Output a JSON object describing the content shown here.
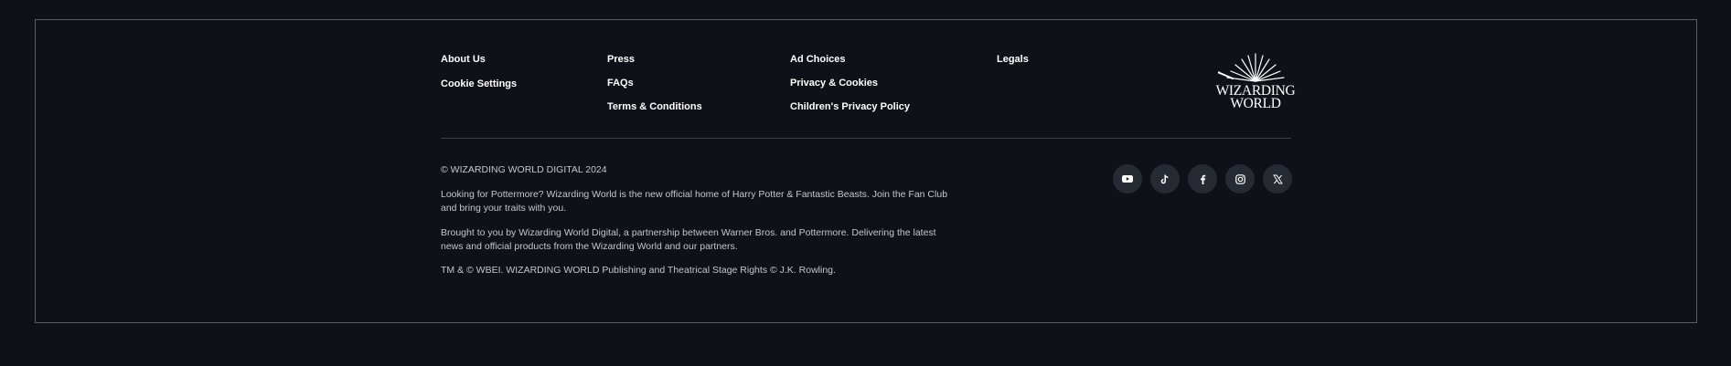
{
  "footer": {
    "nav_columns": [
      {
        "links": [
          {
            "label": "About Us"
          },
          {
            "label": "Cookie Settings"
          }
        ]
      },
      {
        "links": [
          {
            "label": "Press"
          },
          {
            "label": "FAQs"
          },
          {
            "label": "Terms & Conditions"
          }
        ]
      },
      {
        "links": [
          {
            "label": "Ad Choices"
          },
          {
            "label": "Privacy & Cookies"
          },
          {
            "label": "Children's Privacy Policy"
          }
        ]
      },
      {
        "links": [
          {
            "label": "Legals"
          }
        ]
      }
    ],
    "logo": {
      "line1": "WIZARDING",
      "line2": "WORLD"
    },
    "copyright": "© WIZARDING WORLD DIGITAL 2024",
    "pottermore_text": "Looking for Pottermore? Wizarding World is the new official home of Harry Potter & Fantastic Beasts. Join the Fan Club and bring your traits with you.",
    "brought_text": "Brought to you by Wizarding World Digital, a partnership between Warner Bros. and Pottermore. Delivering the latest news and official products from the Wizarding World and our partners.",
    "rights_text": "TM & © WBEI. WIZARDING WORLD Publishing and Theatrical Stage Rights © J.K. Rowling.",
    "socials": [
      {
        "icon": "youtube-icon"
      },
      {
        "icon": "tiktok-icon"
      },
      {
        "icon": "facebook-icon"
      },
      {
        "icon": "instagram-icon"
      },
      {
        "icon": "x-icon"
      }
    ]
  },
  "colors": {
    "background": "#0e1118",
    "border": "#5a5e66",
    "link_text": "#ffffff",
    "body_text": "#c3c7cf",
    "social_bg": "#262a33"
  }
}
